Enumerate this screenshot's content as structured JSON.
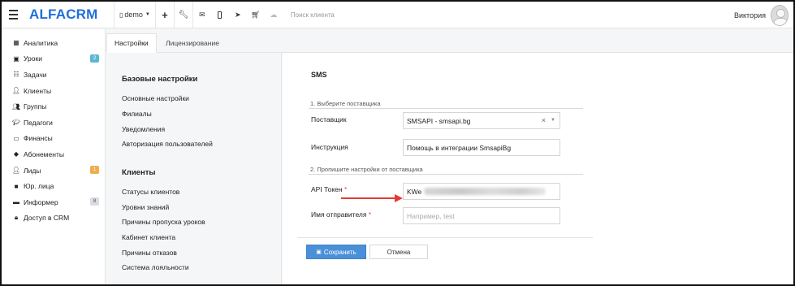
{
  "topbar": {
    "logo_alfa": "ALFA",
    "logo_crm": "CRM",
    "account": "demo",
    "search_placeholder": "Поиск клиента",
    "user_name": "Виктория"
  },
  "sidebar": {
    "items": [
      {
        "label": "Аналитика",
        "icon": "map-icon"
      },
      {
        "label": "Уроки",
        "icon": "calendar-icon",
        "badge": "2",
        "badge_color": "#5ab8d2"
      },
      {
        "label": "Задачи",
        "icon": "checklist-icon"
      },
      {
        "label": "Клиенты",
        "icon": "user-icon"
      },
      {
        "label": "Группы",
        "icon": "users-icon"
      },
      {
        "label": "Педагоги",
        "icon": "graduation-cap-icon"
      },
      {
        "label": "Финансы",
        "icon": "money-icon"
      },
      {
        "label": "Абонементы",
        "icon": "tag-icon"
      },
      {
        "label": "Лиды",
        "icon": "user-plus-icon",
        "badge": "1",
        "badge_color": "#f0ad4e"
      },
      {
        "label": "Юр. лица",
        "icon": "briefcase-icon"
      },
      {
        "label": "Информер",
        "icon": "message-icon",
        "badge": "8",
        "badge_color": "#d9dde1"
      },
      {
        "label": "Доступ в CRM",
        "icon": "lock-icon"
      }
    ]
  },
  "tabs": [
    {
      "label": "Настройки",
      "active": true
    },
    {
      "label": "Лицензирование",
      "active": false
    }
  ],
  "settings_menu": {
    "base_title": "Базовые настройки",
    "base_items": [
      "Основные настройки",
      "Филиалы",
      "Уведомления",
      "Авторизация пользователей"
    ],
    "clients_title": "Клиенты",
    "clients_items": [
      "Статусы клиентов",
      "Уровни знаний",
      "Причины пропуска уроков",
      "Кабинет клиента",
      "Причины отказов",
      "Система лояльности"
    ]
  },
  "sms": {
    "title": "SMS",
    "step1": "1. Выберите поставщика",
    "provider_label": "Поставщик",
    "provider_value": "SMSAPI - smsapi.bg",
    "instruction_label": "Инструкция",
    "instruction_value": "Помощь в интеграции SmsapiBg",
    "step2": "2. Пропишите настройки от поставщика",
    "token_label": "API Токен",
    "token_value": "KWe",
    "sender_label": "Имя отправителя",
    "sender_placeholder": "Например, test",
    "required_mark": "*",
    "save_label": "Сохранить",
    "cancel_label": "Отмена",
    "accent_color": "#4a90d9",
    "arrow_color": "#e53935"
  }
}
